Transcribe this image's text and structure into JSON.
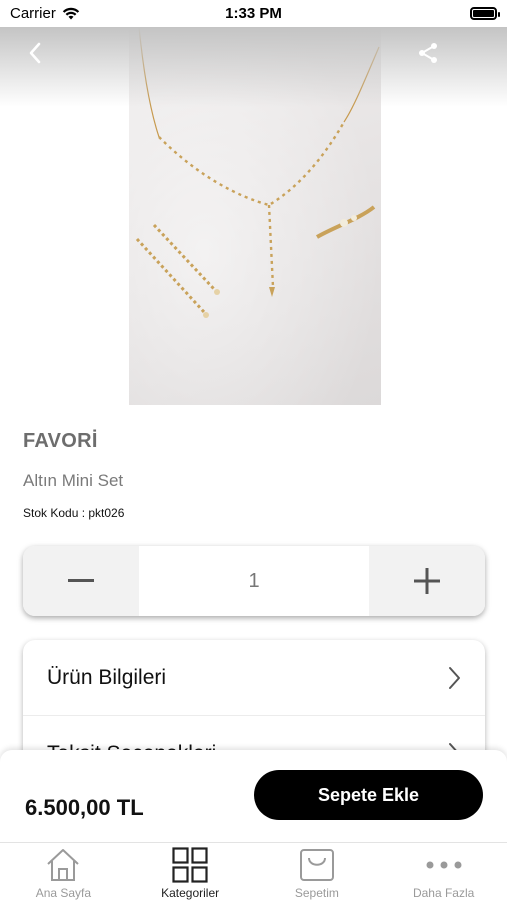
{
  "status_bar": {
    "carrier": "Carrier",
    "time": "1:33 PM"
  },
  "header": {
    "back_icon": "chevron-left-icon",
    "share_icon": "share-icon"
  },
  "product": {
    "brand": "FAVORİ",
    "name": "Altın Mini Set",
    "sku": "Stok Kodu : pkt026",
    "quantity": "1",
    "price": "6.500,00 TL"
  },
  "info_rows": [
    {
      "label": "Ürün Bilgileri"
    },
    {
      "label": "Taksit Seçenekleri"
    }
  ],
  "actions": {
    "add_to_cart": "Sepete Ekle"
  },
  "tab_bar": {
    "tabs": [
      {
        "label": "Ana Sayfa",
        "icon": "home-icon"
      },
      {
        "label": "Kategoriler",
        "icon": "grid-icon",
        "active": true
      },
      {
        "label": "Sepetim",
        "icon": "bag-icon"
      },
      {
        "label": "Daha Fazla",
        "icon": "more-icon"
      }
    ]
  },
  "colors": {
    "button_dark": "#000000",
    "muted_text": "#7a7a7a",
    "tab_inactive": "#9a9a9a"
  }
}
